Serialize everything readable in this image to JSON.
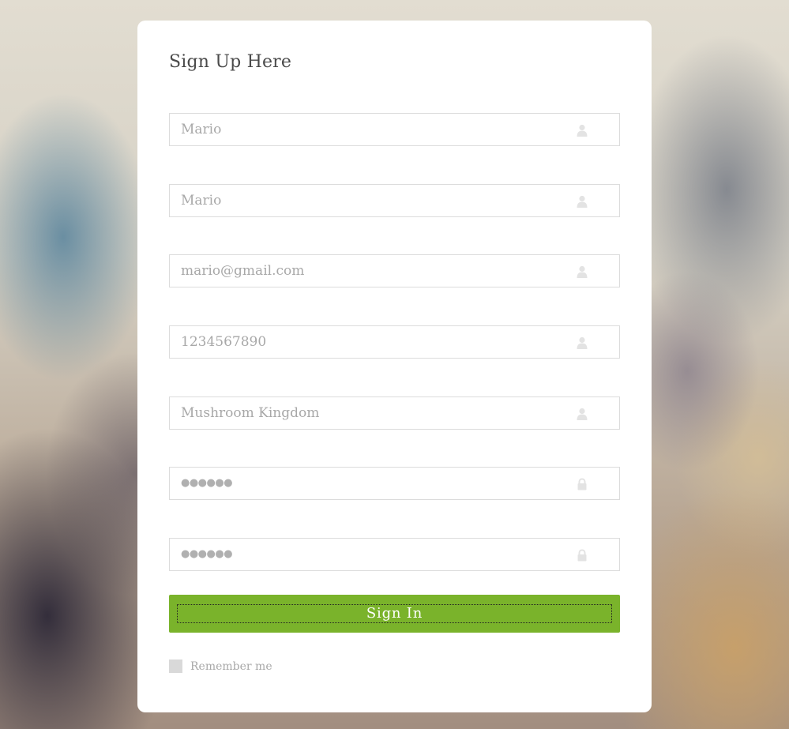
{
  "form": {
    "title": "Sign Up Here",
    "fields": [
      {
        "value": "Mario",
        "icon": "user-icon"
      },
      {
        "value": "Mario",
        "icon": "user-icon"
      },
      {
        "value": "mario@gmail.com",
        "icon": "user-icon"
      },
      {
        "value": "1234567890",
        "icon": "user-icon"
      },
      {
        "value": "Mushroom Kingdom",
        "icon": "user-icon"
      },
      {
        "value": "●●●●●●",
        "icon": "lock-icon"
      },
      {
        "value": "●●●●●●",
        "icon": "lock-icon"
      }
    ],
    "submit_label": "Sign In",
    "remember_label": "Remember me",
    "remember_checked": false
  },
  "colors": {
    "button": "#7ab32b",
    "field_border": "#dcdcdc",
    "placeholder_text": "#a8a8a8",
    "icon": "#e3e3e3"
  }
}
